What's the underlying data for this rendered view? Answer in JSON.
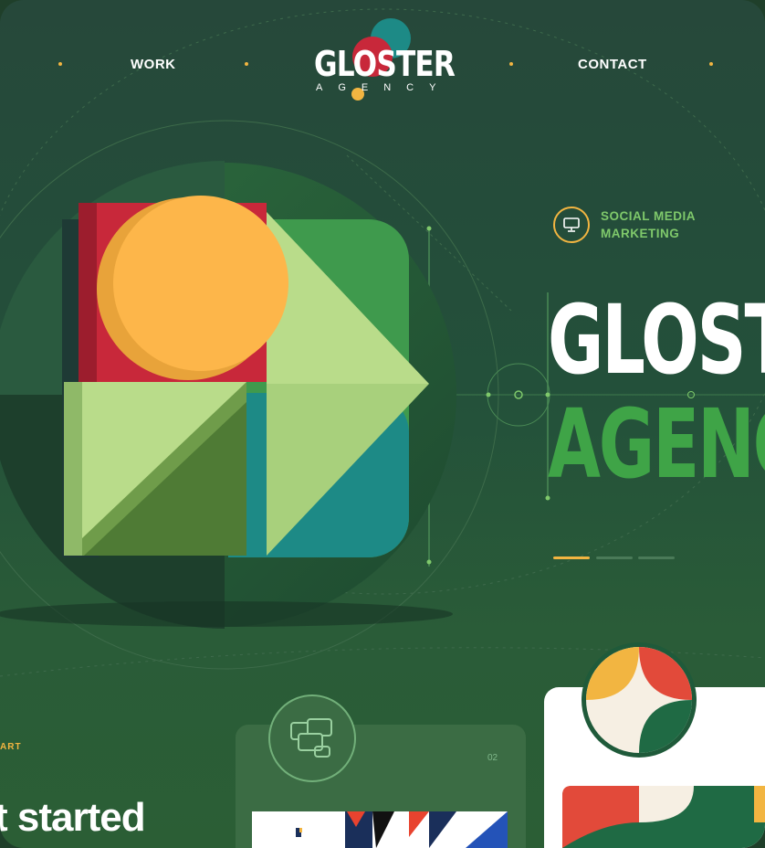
{
  "nav": {
    "links": [
      "WORK",
      "CONTACT"
    ]
  },
  "logo": {
    "word": "GLOSTER",
    "sub": "AGENCY"
  },
  "hero": {
    "tag_line1": "SOCIAL MEDIA",
    "tag_line2": "MARKETING",
    "title": "GLOSTER",
    "subtitle": "AGENCY",
    "slider_active": 1,
    "slider_total": 3
  },
  "lower": {
    "section_label": "ART",
    "cta": "t started",
    "card_number": "02"
  },
  "colors": {
    "accent_yellow": "#f2b541",
    "brand_green": "#3fa447",
    "red": "#c8283a",
    "teal": "#1d8a86",
    "light_green": "#b9dc8a"
  },
  "icons": [
    "monitor-icon",
    "screens-icon"
  ]
}
